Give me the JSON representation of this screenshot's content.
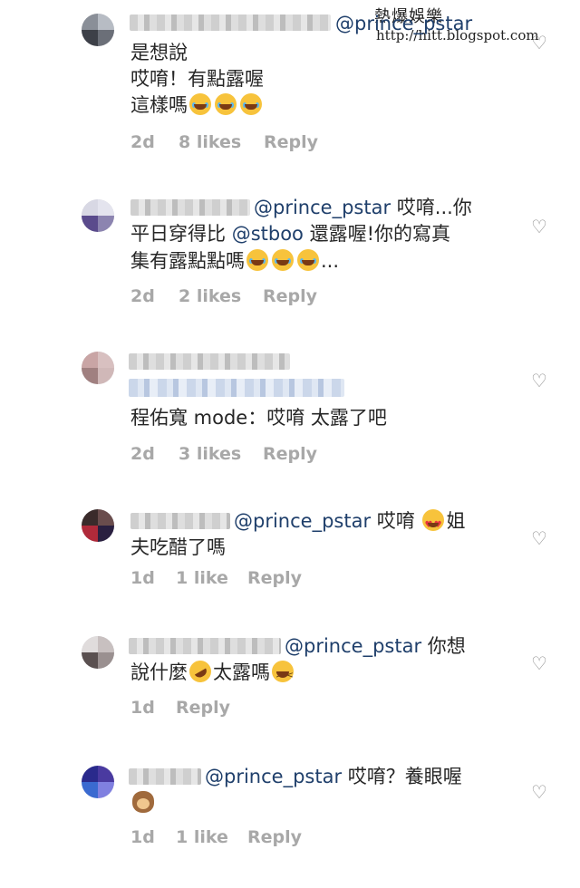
{
  "watermark": {
    "title": "熱爆娛樂",
    "url": "http://hitt.blogspot.com"
  },
  "comments": [
    {
      "mention": "@prince_pstar",
      "lines": [
        "是想說",
        "哎唷！有點露喔",
        "這樣嗎"
      ],
      "time": "2d",
      "likes": "8 likes",
      "reply": "Reply"
    },
    {
      "mention": "@prince_pstar",
      "line1_tail": " 哎唷...你",
      "line2_pre": "平日穿得比 ",
      "line2_mention": "@stboo",
      "line2_post": " 還露喔!你的寫真",
      "line3": "集有露點點嗎",
      "line3_tail": "...",
      "time": "2d",
      "likes": "2 likes",
      "reply": "Reply"
    },
    {
      "line1": "程佑寬 mode：哎唷 太露了吧",
      "time": "2d",
      "likes": "3 likes",
      "reply": "Reply"
    },
    {
      "mention": "@prince_pstar",
      "line1_tail": " 哎唷 ",
      "line1_end": "姐",
      "line2": "夫吃醋了嗎",
      "time": "1d",
      "likes": "1 like",
      "reply": "Reply"
    },
    {
      "mention": "@prince_pstar",
      "line1_tail": " 你想",
      "line2_pre": "說什麼",
      "line2_mid": "太露嗎",
      "time": "1d",
      "reply": "Reply"
    },
    {
      "mention": "@prince_pstar",
      "line1_tail": " 哎唷？養眼喔",
      "time": "1d",
      "likes": "1 like",
      "reply": "Reply"
    }
  ],
  "icons": {
    "like": "heart-outline-icon",
    "emoji_laugh": "face-with-tears-of-joy-icon",
    "emoji_hearts": "heart-eyes-icon",
    "emoji_rofl": "rolling-laughing-icon",
    "emoji_grin": "grinning-squinting-icon",
    "emoji_monkey": "see-no-evil-monkey-icon"
  },
  "colors": {
    "text": "#262626",
    "mention": "#1f3f6b",
    "meta": "#a8a8a8",
    "heart": "#8e8e8e"
  }
}
